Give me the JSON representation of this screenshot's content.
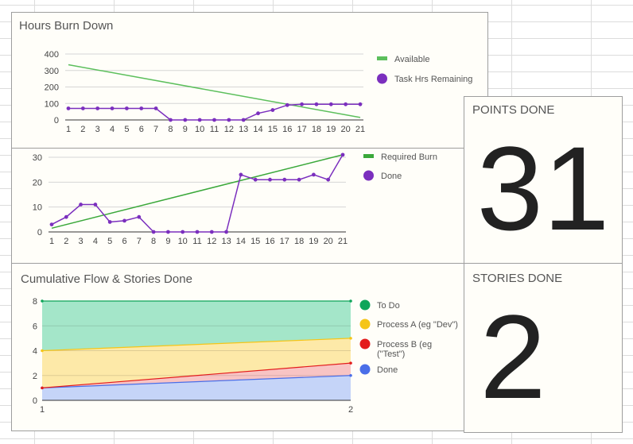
{
  "panels": {
    "burn_down_title": "Hours Burn Down",
    "cfd_title": "Cumulative Flow & Stories Done",
    "points_title": "POINTS DONE",
    "points_value": "31",
    "stories_title": "STORIES DONE",
    "stories_value": "2"
  },
  "colors": {
    "available": "#5cbf5c",
    "task_hrs": "#7b2fbe",
    "required": "#3aa83a",
    "done": "#7b2fbe",
    "todo_area": "#a4e6c9",
    "todo_line": "#0fa55a",
    "process_a_area": "#fde9a8",
    "process_a_line": "#f5c518",
    "process_b_area": "#f8c4c4",
    "process_b_line": "#e31b1b",
    "done_area": "#c5d4f8",
    "done_line": "#4a6ee8"
  },
  "chart_data": [
    {
      "type": "line",
      "id": "hours-burn-down",
      "title": "Hours Burn Down",
      "x": [
        1,
        2,
        3,
        4,
        5,
        6,
        7,
        8,
        9,
        10,
        11,
        12,
        13,
        14,
        15,
        16,
        17,
        18,
        19,
        20,
        21
      ],
      "ylim": [
        0,
        400
      ],
      "yticks": [
        0,
        100,
        200,
        300,
        400
      ],
      "series": [
        {
          "name": "Available",
          "x_start": 1,
          "x_end": 21,
          "y_start": 335,
          "y_end": 15
        },
        {
          "name": "Task Hrs Remaining",
          "values": [
            70,
            70,
            70,
            70,
            70,
            70,
            70,
            0,
            0,
            0,
            0,
            0,
            0,
            40,
            60,
            90,
            95,
            95,
            95,
            95,
            95
          ]
        }
      ],
      "legend": "right"
    },
    {
      "type": "line",
      "id": "points-burn-up",
      "x": [
        1,
        2,
        3,
        4,
        5,
        6,
        7,
        8,
        9,
        10,
        11,
        12,
        13,
        14,
        15,
        16,
        17,
        18,
        19,
        20,
        21
      ],
      "ylim": [
        0,
        30
      ],
      "yticks": [
        0,
        10,
        20,
        30
      ],
      "series": [
        {
          "name": "Required Burn",
          "x_start": 1,
          "x_end": 21,
          "y_start": 1.5,
          "y_end": 31
        },
        {
          "name": "Done",
          "values": [
            3,
            6,
            11,
            11,
            4,
            4.5,
            6,
            0,
            0,
            0,
            0,
            0,
            0,
            23,
            21,
            21,
            21,
            21,
            23,
            21,
            31
          ]
        }
      ],
      "legend": "right"
    },
    {
      "type": "area",
      "id": "cumulative-flow",
      "title": "Cumulative Flow & Stories Done",
      "x": [
        1,
        2
      ],
      "ylim": [
        0,
        8
      ],
      "yticks": [
        0,
        2,
        4,
        6,
        8
      ],
      "stacked": true,
      "series": [
        {
          "name": "To Do",
          "values": [
            4,
            3
          ]
        },
        {
          "name": "Process A (eg \"Dev\")",
          "values": [
            3,
            2
          ]
        },
        {
          "name": "Process B (eg (\"Test\")",
          "values": [
            0,
            1
          ]
        },
        {
          "name": "Done",
          "values": [
            1,
            2
          ]
        }
      ],
      "legend": "right"
    }
  ]
}
